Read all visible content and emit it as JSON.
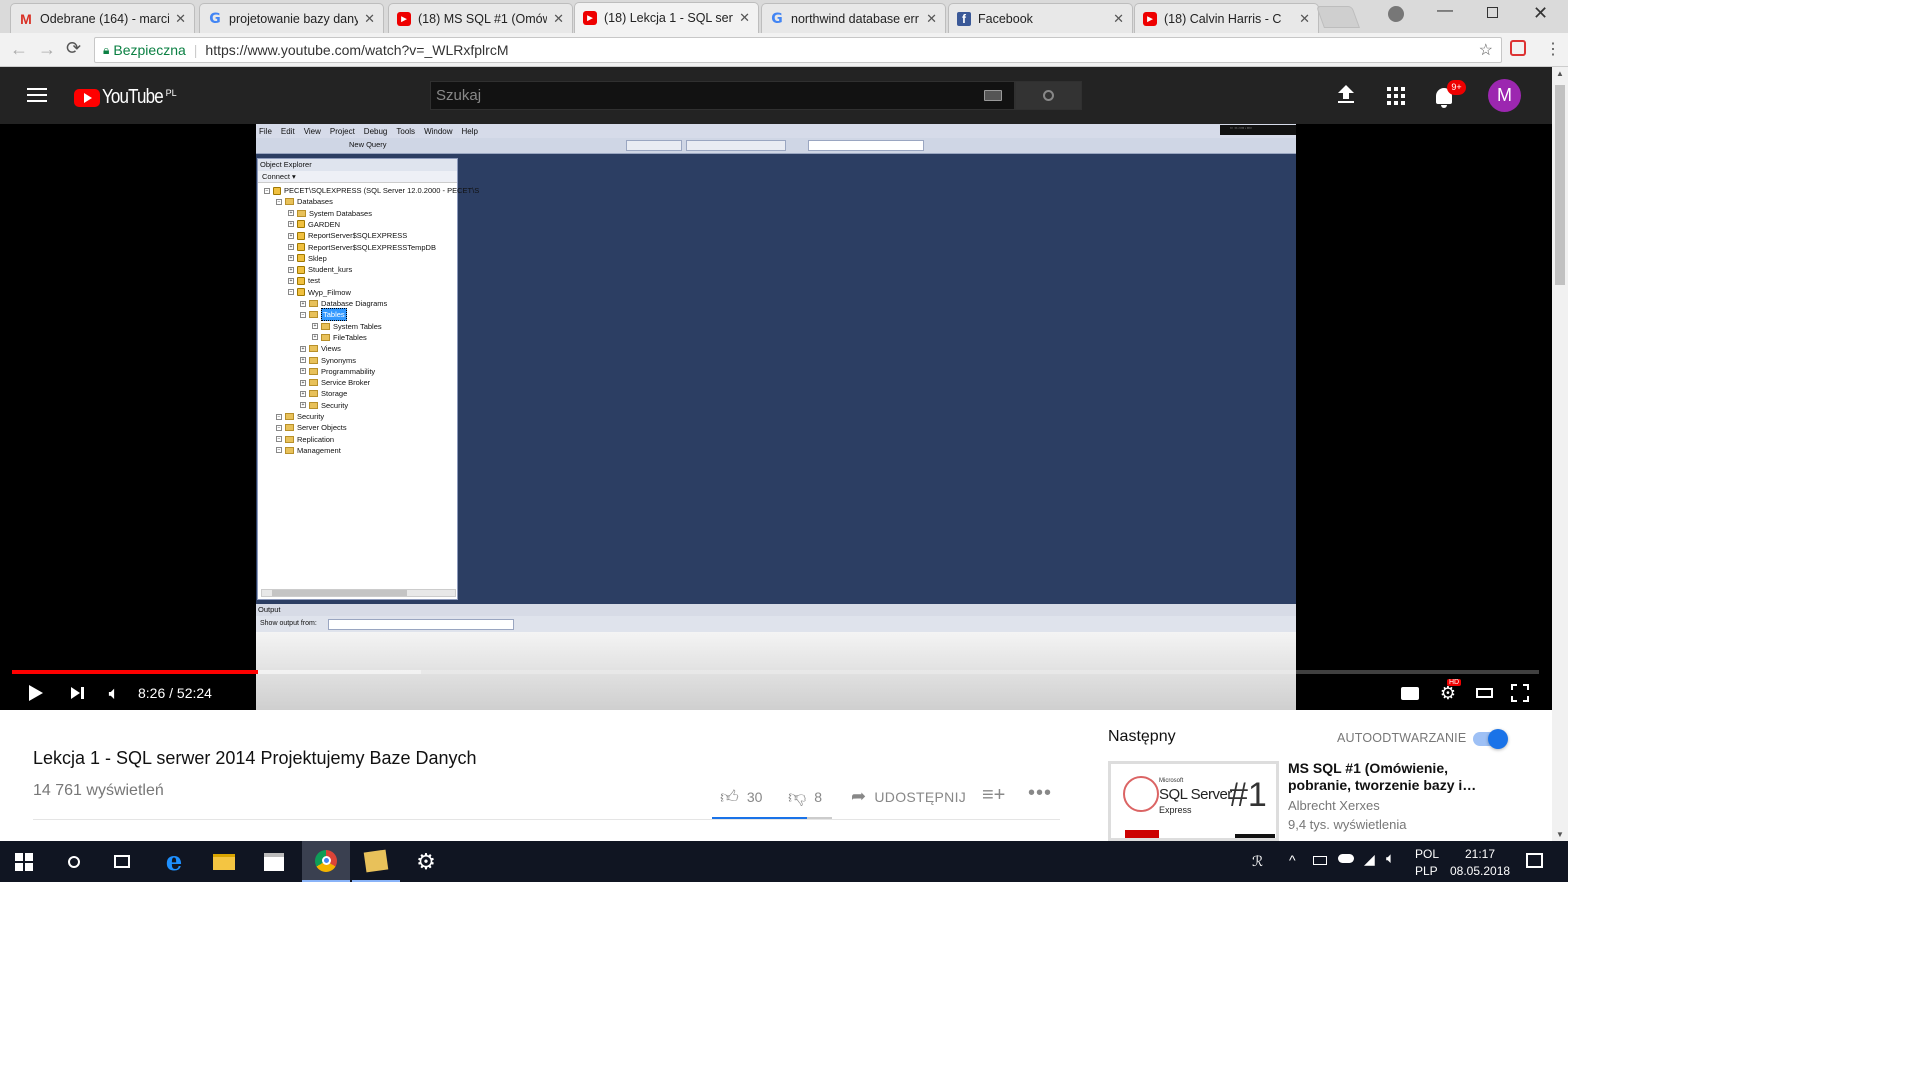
{
  "tabs": [
    {
      "label": "Odebrane (164) - marci",
      "icon": "gmail-icon",
      "active": false
    },
    {
      "label": "projetowanie bazy dany",
      "icon": "google-icon",
      "active": false
    },
    {
      "label": "(18) MS SQL #1 (Omów",
      "icon": "youtube-icon",
      "active": false
    },
    {
      "label": "(18) Lekcja 1 - SQL serw",
      "icon": "youtube-icon",
      "active": true
    },
    {
      "label": "northwind database err",
      "icon": "google-icon",
      "active": false
    },
    {
      "label": "Facebook",
      "icon": "facebook-icon",
      "active": false
    },
    {
      "label": "(18) Calvin Harris - C",
      "icon": "youtube-icon",
      "active": false
    }
  ],
  "address": {
    "secure_label": "Bezpieczna",
    "url": "https://www.youtube.com/watch?v=_WLRxfplrcM"
  },
  "youtube": {
    "logo": "YouTube",
    "region": "PL",
    "search_placeholder": "Szukaj",
    "notif_badge": "9+",
    "avatar_letter": "M",
    "avatar_color": "#9c27b0"
  },
  "video": {
    "ssms_menu": [
      "File",
      "Edit",
      "View",
      "Project",
      "Debug",
      "Tools",
      "Window",
      "Help"
    ],
    "new_query": "New Query",
    "object_explorer": {
      "title": "Object Explorer",
      "connect": "Connect ▾",
      "tree": [
        {
          "label": "PECET\\SQLEXPRESS (SQL Server 12.0.2000 - PECET\\S",
          "indent": 0,
          "type": "server"
        },
        {
          "label": "Databases",
          "indent": 1,
          "type": "folder"
        },
        {
          "label": "System Databases",
          "indent": 2,
          "type": "folder"
        },
        {
          "label": "GARDEN",
          "indent": 2,
          "type": "db"
        },
        {
          "label": "ReportServer$SQLEXPRESS",
          "indent": 2,
          "type": "db"
        },
        {
          "label": "ReportServer$SQLEXPRESSTempDB",
          "indent": 2,
          "type": "db"
        },
        {
          "label": "Sklep",
          "indent": 2,
          "type": "db"
        },
        {
          "label": "Student_kurs",
          "indent": 2,
          "type": "db"
        },
        {
          "label": "test",
          "indent": 2,
          "type": "db"
        },
        {
          "label": "Wyp_Filmow",
          "indent": 2,
          "type": "db"
        },
        {
          "label": "Database Diagrams",
          "indent": 3,
          "type": "folder"
        },
        {
          "label": "Tables",
          "indent": 3,
          "type": "folder",
          "selected": true
        },
        {
          "label": "System Tables",
          "indent": 4,
          "type": "folder"
        },
        {
          "label": "FileTables",
          "indent": 4,
          "type": "folder"
        },
        {
          "label": "Views",
          "indent": 3,
          "type": "folder"
        },
        {
          "label": "Synonyms",
          "indent": 3,
          "type": "folder"
        },
        {
          "label": "Programmability",
          "indent": 3,
          "type": "folder"
        },
        {
          "label": "Service Broker",
          "indent": 3,
          "type": "folder"
        },
        {
          "label": "Storage",
          "indent": 3,
          "type": "folder"
        },
        {
          "label": "Security",
          "indent": 3,
          "type": "folder"
        },
        {
          "label": "Security",
          "indent": 1,
          "type": "folder"
        },
        {
          "label": "Server Objects",
          "indent": 1,
          "type": "folder"
        },
        {
          "label": "Replication",
          "indent": 1,
          "type": "folder"
        },
        {
          "label": "Management",
          "indent": 1,
          "type": "folder"
        }
      ]
    },
    "output": {
      "title": "Output",
      "show_from": "Show output from:"
    },
    "progress": 0.1612,
    "buffered": 0.268,
    "time": "8:26 / 52:24"
  },
  "info": {
    "title": "Lekcja 1 - SQL serwer 2014 Projektujemy Baze Danych",
    "views": "14 761 wyświetleń",
    "likes": "30",
    "dislikes": "8",
    "share": "UDOSTĘPNIJ"
  },
  "upnext": {
    "heading": "Następny",
    "autoplay_label": "AUTOODTWARZANIE",
    "autoplay_on": true,
    "accent": "#1a73e8",
    "title": "MS SQL #1 (Omówienie, pobranie, tworzenie bazy i…",
    "channel": "Albrecht Xerxes",
    "views": "9,4 tys. wyświetlenia",
    "thumb_brand": "SQL Server",
    "thumb_sub": "Express",
    "thumb_small": "Microsoft",
    "thumb_num": "#1"
  },
  "taskbar": {
    "lang1": "POL",
    "lang2": "PLP",
    "time": "21:17",
    "date": "08.05.2018"
  }
}
